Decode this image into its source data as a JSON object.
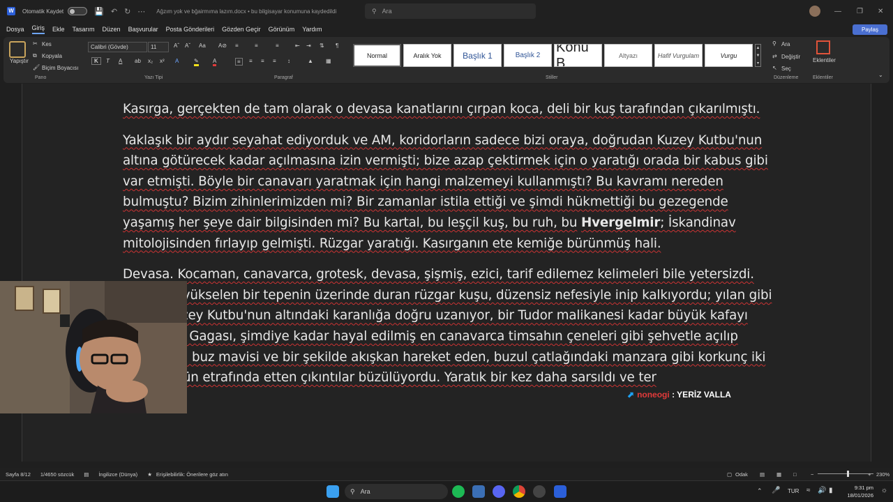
{
  "titlebar": {
    "autosave_label": "Otomatik Kaydet",
    "doc_title": "Ağzım yok  ve bğairmıma lazım.docx  •  bu bilgisayar konumuna kaydedildi",
    "search_placeholder": "Ara"
  },
  "menu": {
    "items": [
      "Dosya",
      "Giriş",
      "Ekle",
      "Tasarım",
      "Düzen",
      "Başvurular",
      "Posta Gönderileri",
      "Gözden Geçir",
      "Görünüm",
      "Yardım"
    ],
    "share_label": "Paylaş"
  },
  "ribbon": {
    "clipboard": {
      "paste": "Yapıştır",
      "cut": "Kes",
      "copy": "Kopyala",
      "format_painter": "Biçim Boyacısı",
      "group": "Pano"
    },
    "font": {
      "family": "Calibri (Gövde)",
      "size": "11",
      "group": "Yazı Tipi"
    },
    "paragraph_group": "Paragraf",
    "styles": {
      "group": "Stiller",
      "items": [
        "Normal",
        "Aralık Yok",
        "Başlık 1",
        "Başlık 2",
        "Konu B",
        "Altyazı",
        "Hafif Vurgulam",
        "Vurgu"
      ]
    },
    "editing": {
      "find": "Ara",
      "replace": "Değiştir",
      "select": "Seç",
      "group": "Düzenleme"
    },
    "addins": {
      "label": "Eklentiler",
      "group": "Eklentiler"
    }
  },
  "document": {
    "paragraphs": [
      "Kasırga, gerçekten de tam olarak o devasa kanatlarını çırpan koca, deli bir kuş tarafından çıkarılmıştı.",
      "Yaklaşık bir aydır seyahat ediyorduk ve AM, koridorların sadece bizi oraya, doğrudan Kuzey Kutbu'nun altına götürecek kadar açılmasına izin vermişti; bize azap çektirmek için o yaratığı orada bir kabus gibi var etmişti. Böyle bir canavarı yaratmak için hangi malzemeyi kullanmıştı? Bu kavramı nereden bulmuştu? Bizim zihinlerimizden mi? Bir zamanlar istila ettiği ve şimdi hükmettiği bu gezegende yaşamış her şeye dair bilgisinden mi? Bu kartal, bu leşçil kuş, bu ruh, bu",
      "Hvergelmir",
      "; İskandinav mitolojisinden fırlayıp gelmişti. Rüzgar yaratığı. Kasırganın ete kemiğe bürünmüş hali.",
      "Devasa. Kocaman, canavarca, grotesk, devasa, şişmiş, ezici, tarif edilemez kelimeleri bile yetersizdi. Üzerinde yükselen bir tepenin üzerinde duran rüzgar kuşu, düzensiz nefesiyle inip kalkıyordu; yılan gibi boynu Kuzey Kutbu'nun altındaki karanlığa doğru uzanıyor, bir Tudor malikanesi kadar büyük kafayı taşıyordu. Gagası, şimdiye kadar hayal edilmiş en canavarca timsahın çeneleri gibi şehvetle açılıp açılıyordu; buz mavisi ve bir şekilde akışkan hareket eden, buzul çatlağındaki manzara gibi korkunç iki habis gözün etrafında etten çıkıntılar büzülüyordu. Yaratık bir kez daha sarsıldı ve ter"
    ]
  },
  "overlay": {
    "name": "noneogi",
    "text": " : YERİZ VALLA"
  },
  "statusbar": {
    "page": "Sayfa 8/12",
    "words": "1/4650 sözcük",
    "language": "İngilizce (Dünya)",
    "accessibility": "Erişilebilirlik: Önerilere göz atın",
    "focus": "Odak",
    "zoom": "230%"
  },
  "taskbar": {
    "search": "Ara",
    "language": "TUR",
    "time": "9:31 pm",
    "date": "18/01/2026"
  }
}
